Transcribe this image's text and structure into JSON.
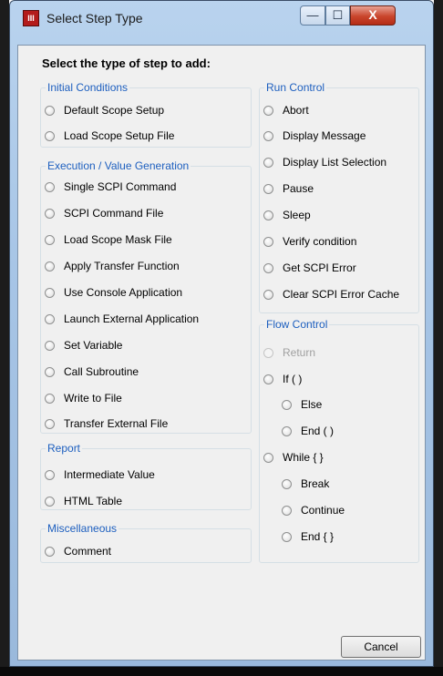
{
  "window": {
    "title": "Select Step Type",
    "icon_glyph": "III",
    "minimize_glyph": "—",
    "maximize_glyph": "☐",
    "close_glyph": "X"
  },
  "heading": "Select the type of step to add:",
  "groups": {
    "initial": {
      "title": "Initial Conditions",
      "items": [
        "Default Scope Setup",
        "Load Scope Setup File"
      ]
    },
    "execution": {
      "title": "Execution / Value Generation",
      "items": [
        "Single SCPI Command",
        "SCPI Command File",
        "Load Scope Mask File",
        "Apply Transfer Function",
        "Use Console Application",
        "Launch External Application",
        "Set Variable",
        "Call Subroutine",
        "Write to File",
        "Transfer External File"
      ]
    },
    "report": {
      "title": "Report",
      "items": [
        "Intermediate Value",
        "HTML Table"
      ]
    },
    "misc": {
      "title": "Miscellaneous",
      "items": [
        "Comment"
      ]
    },
    "run": {
      "title": "Run Control",
      "items": [
        "Abort",
        "Display Message",
        "Display List Selection",
        "Pause",
        "Sleep",
        "Verify condition",
        "Get SCPI Error",
        "Clear SCPI Error Cache"
      ]
    },
    "flow": {
      "title": "Flow Control",
      "items": [
        "Return",
        "If ( )",
        "Else",
        "End ( )",
        "While { }",
        "Break",
        "Continue",
        "End { }"
      ]
    }
  },
  "buttons": {
    "cancel": "Cancel"
  }
}
